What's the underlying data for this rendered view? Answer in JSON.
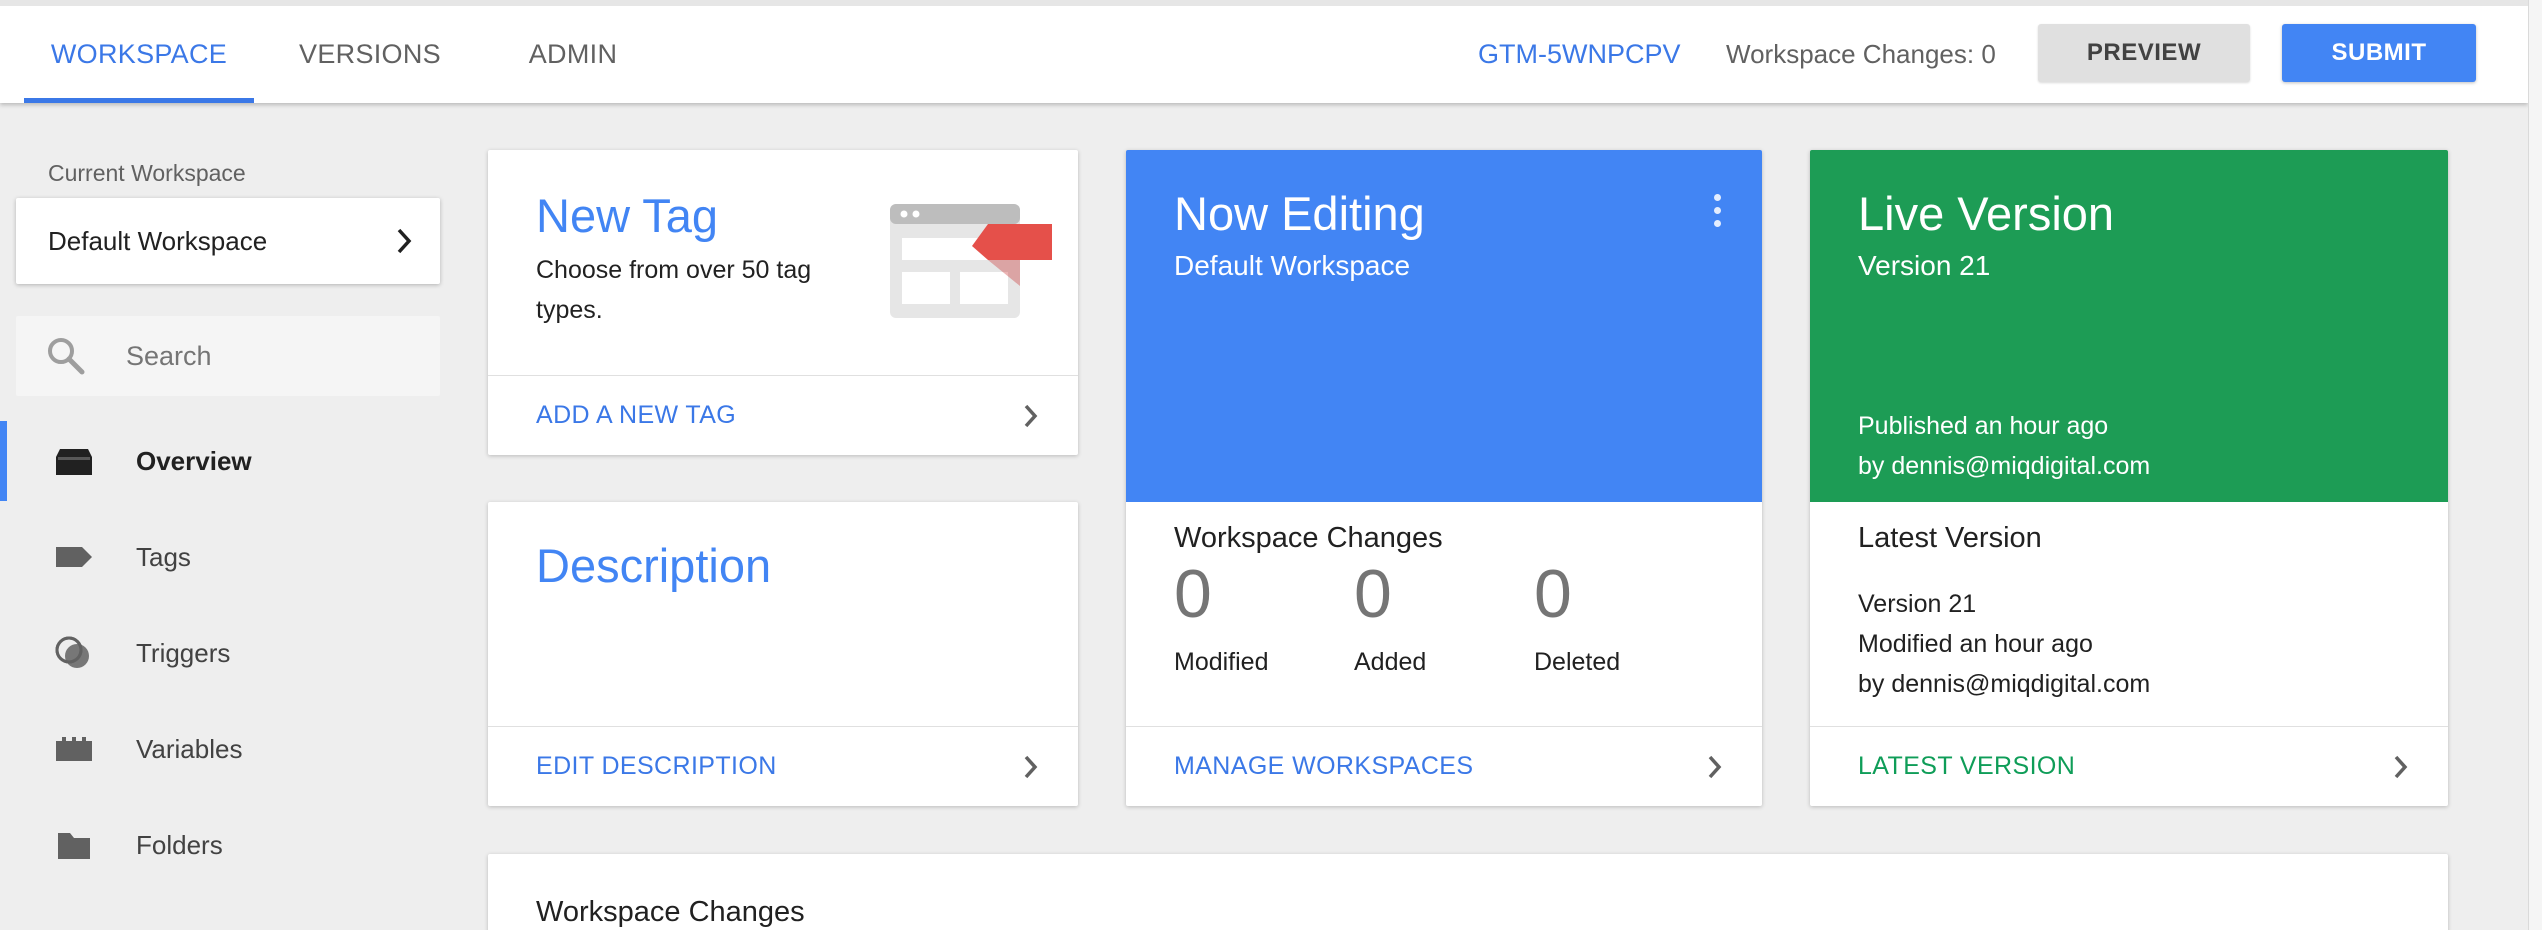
{
  "topbar": {
    "tabs": [
      {
        "label": "WORKSPACE",
        "active": true
      },
      {
        "label": "VERSIONS",
        "active": false
      },
      {
        "label": "ADMIN",
        "active": false
      }
    ],
    "container_id": "GTM-5WNPCPV",
    "workspace_changes": "Workspace Changes: 0",
    "preview_label": "PREVIEW",
    "submit_label": "SUBMIT"
  },
  "sidebar": {
    "current_workspace_label": "Current Workspace",
    "workspace_name": "Default Workspace",
    "search_placeholder": "Search",
    "nav": [
      {
        "label": "Overview",
        "icon": "overview-icon",
        "active": true
      },
      {
        "label": "Tags",
        "icon": "tag-icon",
        "active": false
      },
      {
        "label": "Triggers",
        "icon": "triggers-icon",
        "active": false
      },
      {
        "label": "Variables",
        "icon": "variables-icon",
        "active": false
      },
      {
        "label": "Folders",
        "icon": "folder-icon",
        "active": false
      }
    ]
  },
  "new_tag_card": {
    "title": "New Tag",
    "description": "Choose from over 50 tag types.",
    "link": "ADD A NEW TAG"
  },
  "description_card": {
    "title": "Description",
    "link": "EDIT DESCRIPTION"
  },
  "now_editing_card": {
    "title": "Now Editing",
    "subtitle": "Default Workspace",
    "section_title": "Workspace Changes",
    "stats": [
      {
        "value": "0",
        "label": "Modified"
      },
      {
        "value": "0",
        "label": "Added"
      },
      {
        "value": "0",
        "label": "Deleted"
      }
    ],
    "link": "MANAGE WORKSPACES"
  },
  "live_version_card": {
    "title": "Live Version",
    "subtitle": "Version 21",
    "published": "Published an hour ago",
    "published_by": "by dennis@miqdigital.com",
    "section_title": "Latest Version",
    "latest_version": "Version 21",
    "latest_modified": "Modified an hour ago",
    "latest_by": "by dennis@miqdigital.com",
    "link": "LATEST VERSION"
  },
  "workspace_changes_card": {
    "title": "Workspace Changes"
  },
  "colors": {
    "accent_blue": "#4285f4",
    "link_blue": "#3b78e7",
    "live_green": "#1d9c55",
    "tag_red": "#e5504a"
  }
}
